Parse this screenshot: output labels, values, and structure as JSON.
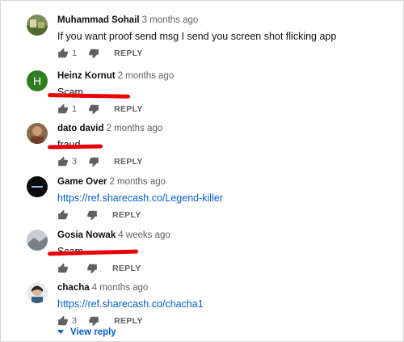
{
  "comments": [
    {
      "author": "Muhammad Sohail",
      "ago": "3 months ago",
      "text": "If you want proof send msg I send you screen shot flicking app",
      "likes": "1",
      "reply_label": "REPLY",
      "avatar_icon": "landscape-photo-avatar",
      "is_link": false
    },
    {
      "author": "Heinz Kornut",
      "ago": "2 months ago",
      "text": "Scam...",
      "likes": "1",
      "reply_label": "REPLY",
      "avatar_icon": "letter-avatar",
      "avatar_letter": "H",
      "avatar_color": "#2e7d1e",
      "is_link": false
    },
    {
      "author": "dato david",
      "ago": "2 months ago",
      "text": "fraud",
      "likes": "3",
      "reply_label": "REPLY",
      "avatar_icon": "person-photo-avatar",
      "is_link": false
    },
    {
      "author": "Game Over",
      "ago": "2 months ago",
      "text": "https://ref.sharecash.co/Legend-killer",
      "likes": "",
      "reply_label": "REPLY",
      "avatar_icon": "dark-logo-avatar",
      "is_link": true
    },
    {
      "author": "Gosia Nowak",
      "ago": "4 weeks ago",
      "text": "Scam",
      "likes": "",
      "reply_label": "REPLY",
      "avatar_icon": "landscape-photo-avatar",
      "is_link": false
    },
    {
      "author": "chacha",
      "ago": "4 months ago",
      "text": "https://ref.sharecash.co/chacha1",
      "likes": "3",
      "reply_label": "REPLY",
      "avatar_icon": "person-photo-avatar",
      "is_link": true
    }
  ],
  "view_reply_label": "View reply",
  "colors": {
    "link": "#065fd4",
    "annotation_red": "#e8000b",
    "muted": "#606060"
  }
}
